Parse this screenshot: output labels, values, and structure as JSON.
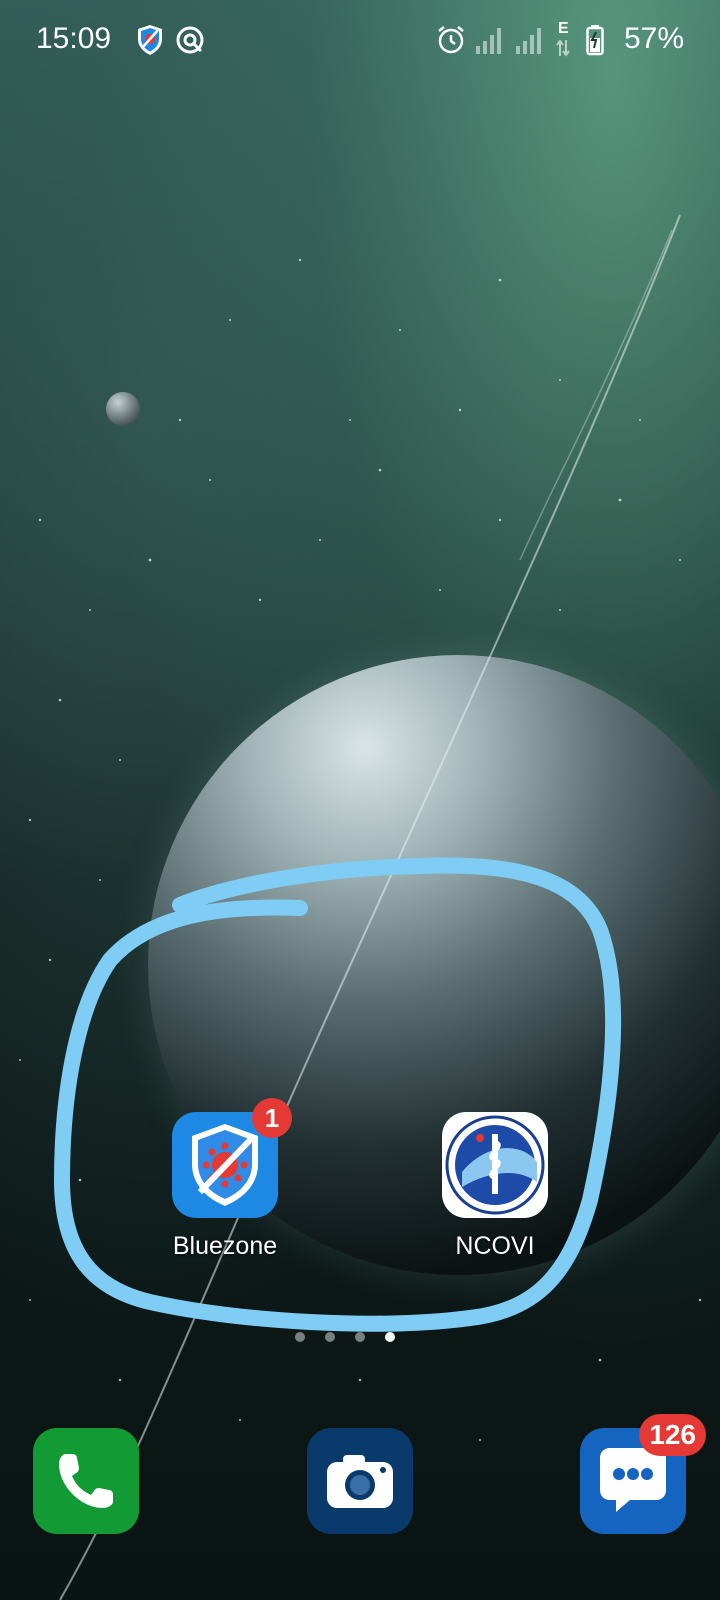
{
  "status_bar": {
    "time": "15:09",
    "battery_percent": "57%",
    "network_type": "E",
    "icons": [
      "bluezone-shield-icon",
      "sync-icon",
      "alarm-icon",
      "signal-icon",
      "signal-icon",
      "data-arrows-icon",
      "battery-icon"
    ]
  },
  "home_apps": [
    {
      "label": "Bluezone",
      "badge": "1",
      "icon": "bluezone-shield-icon"
    },
    {
      "label": "NCOVI",
      "badge": "",
      "icon": "ncovi-logo-icon"
    }
  ],
  "page_indicator": {
    "pages": 4,
    "active_index": 3
  },
  "dock": [
    {
      "name": "Phone",
      "icon": "phone-icon",
      "badge": ""
    },
    {
      "name": "Camera",
      "icon": "camera-icon",
      "badge": ""
    },
    {
      "name": "Messages",
      "icon": "messages-icon",
      "badge": "126"
    }
  ],
  "colors": {
    "highlight_stroke": "#7fcdf5",
    "badge": "#e53935",
    "bluezone_blue": "#1e88e5",
    "phone_green": "#129b34",
    "camera_navy": "#0a3a6b",
    "messages_blue": "#1565c0"
  }
}
